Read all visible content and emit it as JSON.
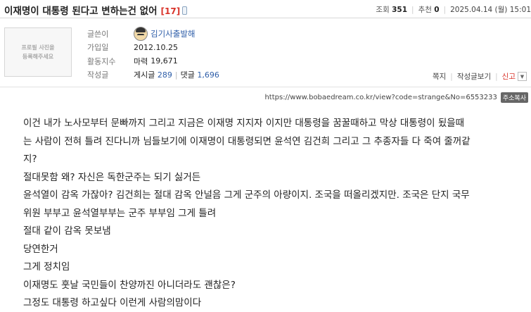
{
  "post": {
    "title": "이재명이 대통령 된다고 변하는건 없어",
    "comment_count": "[17]"
  },
  "meta": {
    "views_label": "조회",
    "views": "351",
    "recommend_label": "추천",
    "recommend": "0",
    "date": "2025.04.14 (월) 15:01"
  },
  "author": {
    "photo_placeholder_line1": "프로필 사진을",
    "photo_placeholder_line2": "등록해주세요",
    "writer_label": "글쓴이",
    "nickname": "김기사출발해",
    "joined_label": "가입일",
    "joined": "2012.10.25",
    "activity_label": "활동지수",
    "mileage_label": "마력",
    "mileage": "19,671",
    "written_label": "작성글",
    "posts_label": "게시글",
    "posts": "289",
    "comments_label": "댓글",
    "comments": "1,696"
  },
  "actions": {
    "message": "쪽지",
    "view_posts": "작성글보기",
    "report": "신고"
  },
  "url": {
    "text": "https://www.bobaedream.co.kr/view?code=strange&No=6553233",
    "copy_label": "주소복사"
  },
  "content": {
    "lines": [
      "이건 내가 노사모부터 문빠까지 그리고 지금은 이재명 지지자 이지만 대통령을 꿈꿀때하고 막상 대통령이 됬을때",
      "는 사람이 전혀 틀려 진다니까 님들보기에 이재명이 대통령되면 윤석연 김건희 그리고 그 추종자들 다 죽여 줄꺼같",
      "지?",
      "절대못함 왜? 자신은 독한군주는 되기 싫거든",
      "윤석열이 감옥 가잖아? 김건희는 절대 감옥 안널음 그게 군주의 아량이지. 조국을 떠올리겠지만. 조국은 단지 국무",
      "위원 부부고 윤석열부부는 군주 부부임 그게 틀려",
      "절대 같이 감옥 못보냄",
      "당연한거",
      "그게 정치임",
      "이재명도 훗날 국민들이 찬양까진 아니더라도 괜찮은?",
      "그정도 대통령 하고싶다 이런게 사람의맘이다"
    ]
  }
}
